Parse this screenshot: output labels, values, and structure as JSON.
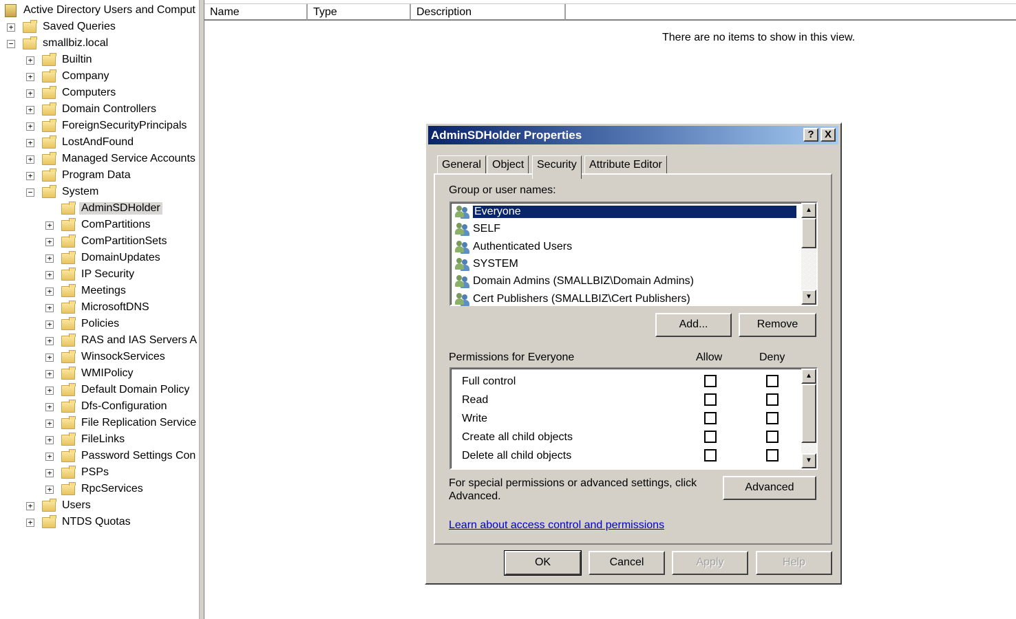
{
  "tree": {
    "root": "Active Directory Users and Comput",
    "items": [
      {
        "label": "Saved Queries",
        "level": 1,
        "exp": "+"
      },
      {
        "label": "smallbiz.local",
        "level": 1,
        "exp": "-",
        "icon": "domain-icon"
      },
      {
        "label": "Builtin",
        "level": 2,
        "exp": "+"
      },
      {
        "label": "Company",
        "level": 2,
        "exp": "+",
        "icon": "ou-icon"
      },
      {
        "label": "Computers",
        "level": 2,
        "exp": "+"
      },
      {
        "label": "Domain Controllers",
        "level": 2,
        "exp": "+",
        "icon": "ou-icon"
      },
      {
        "label": "ForeignSecurityPrincipals",
        "level": 2,
        "exp": "+"
      },
      {
        "label": "LostAndFound",
        "level": 2,
        "exp": "+"
      },
      {
        "label": "Managed Service Accounts",
        "level": 2,
        "exp": "+"
      },
      {
        "label": "Program Data",
        "level": 2,
        "exp": "+"
      },
      {
        "label": "System",
        "level": 2,
        "exp": "-"
      },
      {
        "label": "AdminSDHolder",
        "level": 3,
        "exp": "",
        "selected": true
      },
      {
        "label": "ComPartitions",
        "level": 3,
        "exp": "+"
      },
      {
        "label": "ComPartitionSets",
        "level": 3,
        "exp": "+"
      },
      {
        "label": "DomainUpdates",
        "level": 3,
        "exp": "+"
      },
      {
        "label": "IP Security",
        "level": 3,
        "exp": "+"
      },
      {
        "label": "Meetings",
        "level": 3,
        "exp": "+"
      },
      {
        "label": "MicrosoftDNS",
        "level": 3,
        "exp": "+"
      },
      {
        "label": "Policies",
        "level": 3,
        "exp": "+"
      },
      {
        "label": "RAS and IAS Servers A",
        "level": 3,
        "exp": "+"
      },
      {
        "label": "WinsockServices",
        "level": 3,
        "exp": "+"
      },
      {
        "label": "WMIPolicy",
        "level": 3,
        "exp": "+"
      },
      {
        "label": "Default Domain Policy",
        "level": 3,
        "exp": "+",
        "icon": "policy-icon"
      },
      {
        "label": "Dfs-Configuration",
        "level": 3,
        "exp": "+"
      },
      {
        "label": "File Replication Service",
        "level": 3,
        "exp": "+",
        "icon": "replication-icon"
      },
      {
        "label": "FileLinks",
        "level": 3,
        "exp": "+"
      },
      {
        "label": "Password Settings Con",
        "level": 3,
        "exp": "+"
      },
      {
        "label": "PSPs",
        "level": 3,
        "exp": "+"
      },
      {
        "label": "RpcServices",
        "level": 3,
        "exp": "+",
        "icon": "rpc-icon"
      },
      {
        "label": "Users",
        "level": 2,
        "exp": "+"
      },
      {
        "label": "NTDS Quotas",
        "level": 2,
        "exp": "+"
      }
    ]
  },
  "list": {
    "columns": [
      "Name",
      "Type",
      "Description"
    ],
    "empty": "There are no items to show in this view."
  },
  "dialog": {
    "title": "AdminSDHolder Properties",
    "help_btn": "?",
    "close_btn": "X",
    "tabs": [
      "General",
      "Object",
      "Security",
      "Attribute Editor"
    ],
    "active_tab": "Security",
    "group_label": "Group or user names:",
    "users": [
      "Everyone",
      "SELF",
      "Authenticated Users",
      "SYSTEM",
      "Domain Admins (SMALLBIZ\\Domain Admins)",
      "Cert Publishers (SMALLBIZ\\Cert Publishers)"
    ],
    "selected_user": "Everyone",
    "add": "Add...",
    "remove": "Remove",
    "perm_label": "Permissions for Everyone",
    "allow": "Allow",
    "deny": "Deny",
    "permissions": [
      {
        "name": "Full control",
        "allow": false,
        "deny": false
      },
      {
        "name": "Read",
        "allow": false,
        "deny": false
      },
      {
        "name": "Write",
        "allow": false,
        "deny": false
      },
      {
        "name": "Create all child objects",
        "allow": false,
        "deny": false
      },
      {
        "name": "Delete all child objects",
        "allow": false,
        "deny": false
      }
    ],
    "advanced_text": "For special permissions or advanced settings, click Advanced.",
    "advanced": "Advanced",
    "link": "Learn about access control and permissions",
    "ok": "OK",
    "cancel": "Cancel",
    "apply": "Apply",
    "help": "Help"
  },
  "colors": {
    "selection": "#0a246a",
    "dialog_bg": "#d4d0c8",
    "title_start": "#0a246a",
    "title_end": "#a6caf0"
  }
}
